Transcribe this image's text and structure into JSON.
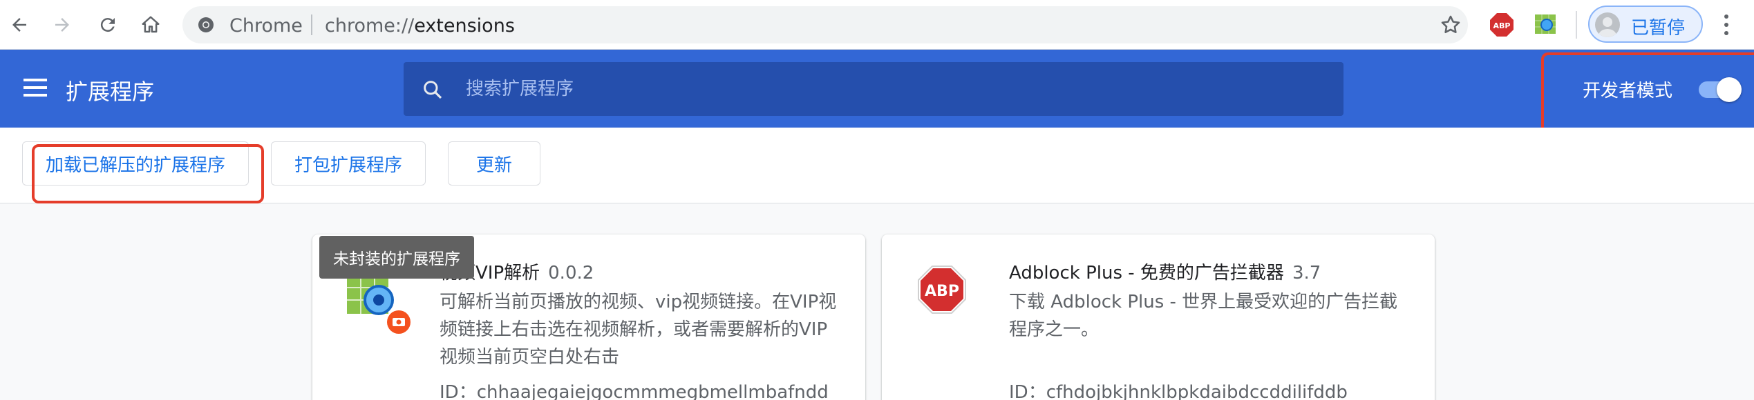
{
  "browser": {
    "omnibox": {
      "site_label": "Chrome",
      "url_scheme": "chrome://",
      "url_host": "extensions"
    },
    "profile_label": "已暂停",
    "extension_icons": [
      "adblock-plus-icon",
      "vip-parse-icon"
    ]
  },
  "header": {
    "title": "扩展程序",
    "search_placeholder": "搜索扩展程序",
    "dev_mode_label": "开发者模式",
    "dev_mode_enabled": true
  },
  "actions": {
    "load_unpacked": "加载已解压的扩展程序",
    "pack": "打包扩展程序",
    "update": "更新"
  },
  "tooltip": "未封装的扩展程序",
  "cards": [
    {
      "name": "视频VIP解析",
      "version": "0.0.2",
      "description": "可解析当前页播放的视频、vip视频链接。在VIP视频链接上右击选在视频解析，或者需要解析的VIP视频当前页空白处右击",
      "id_label": "ID：chhaajegaiejgocmmmegbmellmbafndd"
    },
    {
      "name": "Adblock Plus - 免费的广告拦截器",
      "version": "3.7",
      "description": "下载 Adblock Plus - 世界上最受欢迎的广告拦截程序之一。",
      "id_label": "ID：cfhdojbkjhnklbpkdaibdccddilifddb"
    }
  ],
  "colors": {
    "header_bg": "#3367d6",
    "search_bg": "#254fad",
    "accent": "#1a73e8",
    "annotation": "#e53d2a"
  }
}
